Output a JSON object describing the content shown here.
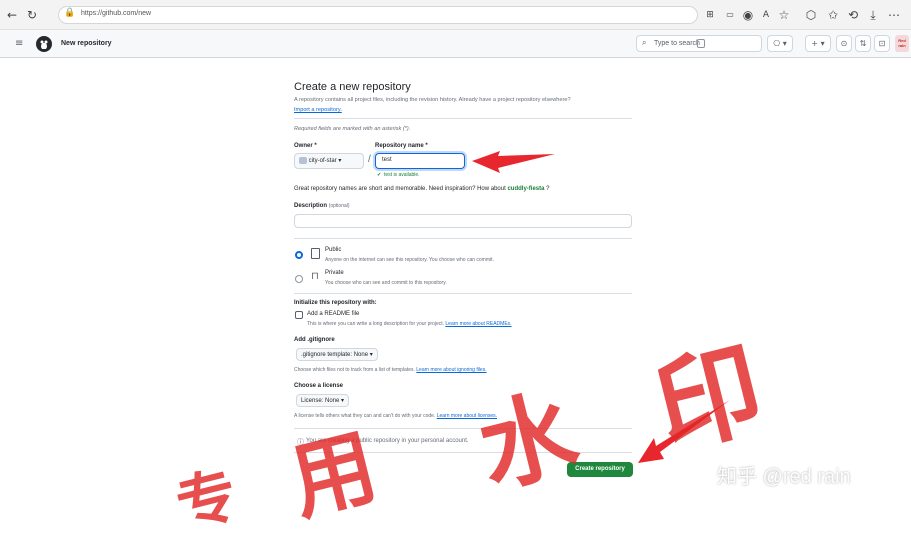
{
  "browser": {
    "url": "https://github.com/new"
  },
  "github_header": {
    "title": "New repository",
    "search_placeholder": "Type to search",
    "avatar_text": "Red\nrain"
  },
  "form": {
    "heading": "Create a new repository",
    "intro": "A repository contains all project files, including the revision history. Already have a project repository elsewhere?",
    "import_link": "Import a repository.",
    "required_note": "Required fields are marked with an asterisk (*).",
    "owner_label": "Owner *",
    "owner_value": "city-of-star",
    "separator": "/",
    "repo_label": "Repository name *",
    "repo_value": "test",
    "available_msg": "test is available.",
    "name_hint": "Great repository names are short and memorable. Need inspiration? How about",
    "suggestion": "cuddly-fiesta",
    "suggestion_suffix": "?",
    "desc_label": "Description",
    "desc_optional": "(optional)",
    "visibility": [
      {
        "label": "Public",
        "desc": "Anyone on the internet can see this repository. You choose who can commit.",
        "selected": true
      },
      {
        "label": "Private",
        "desc": "You choose who can see and commit to this repository.",
        "selected": false
      }
    ],
    "init_heading": "Initialize this repository with:",
    "readme_label": "Add a README file",
    "readme_desc": "This is where you can write a long description for your project.",
    "readme_link": "Learn more about READMEs.",
    "gitignore_heading": "Add .gitignore",
    "gitignore_select": ".gitignore template: None",
    "gitignore_desc": "Choose which files not to track from a list of templates.",
    "gitignore_link": "Learn more about ignoring files.",
    "license_heading": "Choose a license",
    "license_select": "License: None",
    "license_desc": "A license tells others what they can and can't do with your code.",
    "license_link": "Learn more about licenses.",
    "notice": "You are creating a public repository in your personal account.",
    "create_button": "Create repository"
  },
  "watermark": {
    "credit": "知乎 @red rain",
    "stamp": "专用水印"
  },
  "colors": {
    "accent": "#0969da",
    "success": "#1a7f37",
    "create": "#1f883d",
    "annotation": "#e8262d"
  }
}
